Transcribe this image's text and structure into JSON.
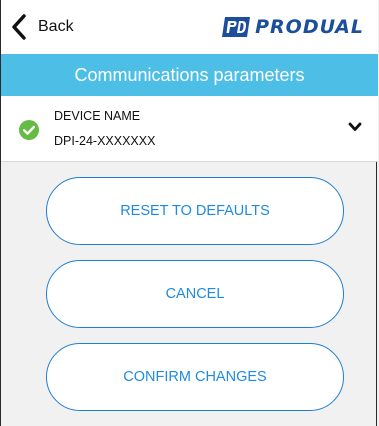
{
  "header": {
    "back_label": "Back",
    "brand_name": "PRODUAL",
    "brand_color": "#1b4f9c"
  },
  "title_bar": {
    "title": "Communications parameters",
    "background": "#4dbfe6"
  },
  "device": {
    "label": "DEVICE NAME",
    "value": "DPI-24-XXXXXXX",
    "status_icon": "check-circle-icon",
    "status_color": "#66bb44",
    "expand_icon": "chevron-down-icon"
  },
  "actions": {
    "reset_label": "RESET TO DEFAULTS",
    "cancel_label": "CANCEL",
    "confirm_label": "CONFIRM CHANGES",
    "accent_color": "#1f8be0"
  }
}
